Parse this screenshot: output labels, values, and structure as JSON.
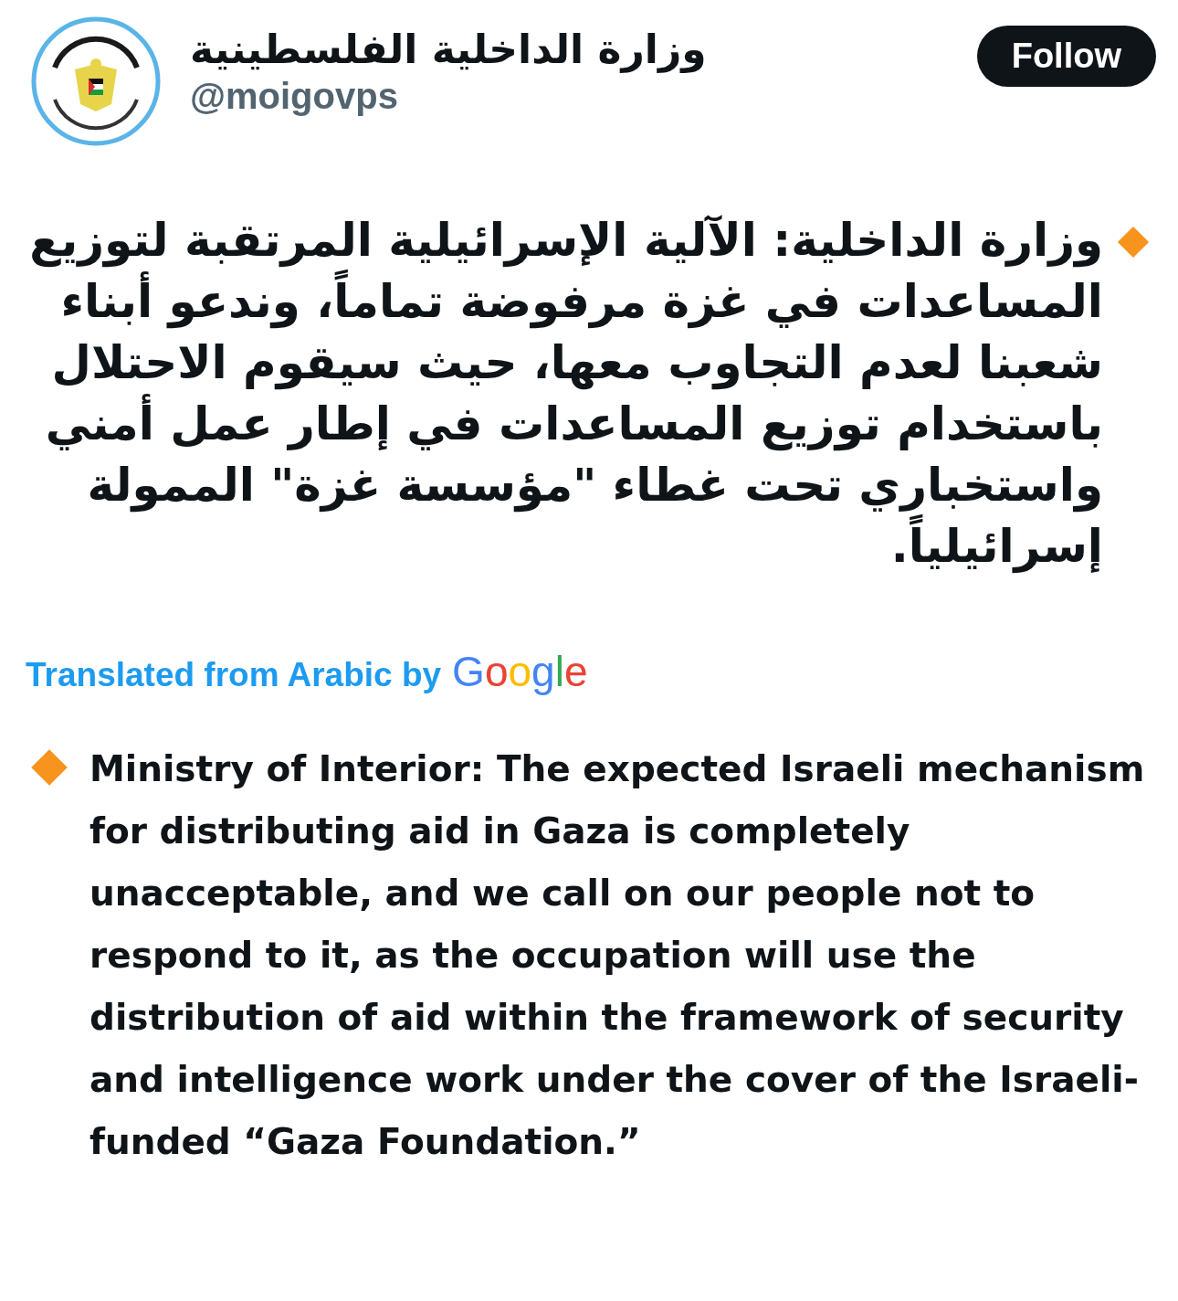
{
  "account": {
    "name": "وزارة الداخلية الفلسطينية",
    "handle": "@moigovps"
  },
  "follow_button": {
    "label": "Follow"
  },
  "post": {
    "text": "وزارة الداخلية: الآلية الإسرائيلية المرتقبة لتوزيع المساعدات في غزة مرفوضة تماماً، وندعو أبناء شعبنا لعدم التجاوب معها، حيث سيقوم الاحتلال باستخدام توزيع المساعدات في إطار عمل أمني واستخباري تحت غطاء \"مؤسسة غزة\" الممولة إسرائيلياً."
  },
  "translation": {
    "label": "Translated from Arabic by",
    "provider": "Google",
    "text": "Ministry of Interior: The expected Israeli mechanism for distributing aid in Gaza is completely unacceptable, and we call on our people not to respond to it, as the occupation will use the distribution of aid within the framework of security and intelligence work under the cover of the Israeli-funded “Gaza Foundation.”"
  }
}
